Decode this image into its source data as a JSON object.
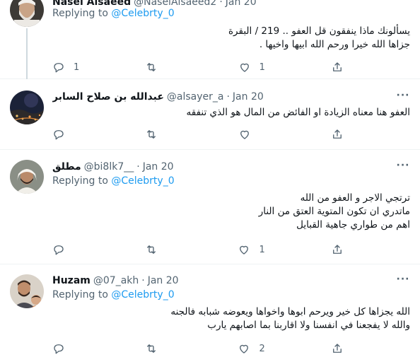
{
  "tweets": [
    {
      "name": "Nasel Alsaeed",
      "handle": "@NaselAlsaeed2",
      "dot": "·",
      "time": "Jan 20",
      "replying_prefix": "Replying to",
      "replying_to": "@Celebrty_0",
      "lines": [
        "يسألونك ماذا ينفقون قل العفو .. 219 / البقرة",
        "جزاها الله خيرا ورحم الله ابيها واخيها ."
      ],
      "replies": "1",
      "retweets": "",
      "likes": "1",
      "avatar_icon": "bearded-man-avatar"
    },
    {
      "name": "عبدالله بن صلاح السابر",
      "handle": "@alsayer_a",
      "dot": "·",
      "time": "Jan 20",
      "replying_prefix": "",
      "replying_to": "",
      "lines": [
        "العفو هنا معناه الزيادة او الفائض من المال هو الذي تنفقه"
      ],
      "replies": "",
      "retweets": "",
      "likes": "",
      "avatar_icon": "night-city-avatar"
    },
    {
      "name": "مطلق",
      "handle": "@bi8lk7__",
      "dot": "·",
      "time": "Jan 20",
      "replying_prefix": "Replying to",
      "replying_to": "@Celebrty_0",
      "lines": [
        "ترتجي الاجر و العفو من الله",
        "ماتدري ان تكون المتوية العتق من النار",
        "اهم من طواري جاهية القبايل"
      ],
      "replies": "",
      "retweets": "",
      "likes": "1",
      "avatar_icon": "man-ghutra-avatar"
    },
    {
      "name": "Huzam",
      "handle": "@07_akh",
      "dot": "·",
      "time": "Jan 20",
      "replying_prefix": "Replying to",
      "replying_to": "@Celebrty_0",
      "lines": [
        "الله يجزاها كل خير ويرحم ابوها واخواها ويعوضه شبابه فالجنه",
        "والله لا يفجعنا في انفسنا ولا اقاربنا بما اصابهم يارب"
      ],
      "replies": "",
      "retweets": "",
      "likes": "2",
      "avatar_icon": "man-child-avatar"
    }
  ],
  "colors": {
    "text": "#0f1419",
    "secondary": "#536471",
    "mention": "#1d9bf0",
    "divider": "#eff3f4",
    "thread_line": "#cfd9de"
  }
}
